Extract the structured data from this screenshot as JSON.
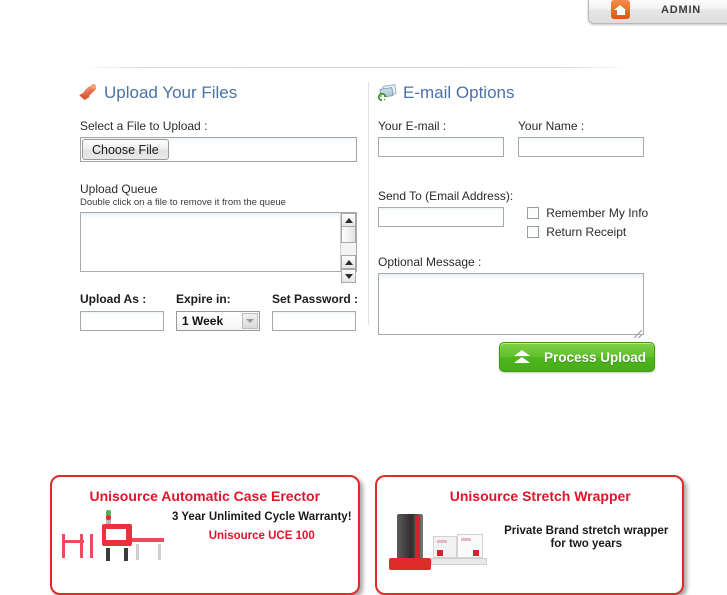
{
  "header": {
    "admin_label": "ADMIN",
    "admin_icon": "home-icon"
  },
  "upload_section": {
    "icon": "rocket-icon",
    "title": "Upload Your Files",
    "select_file_label": "Select a File to Upload :",
    "choose_file_button": "Choose File",
    "file_input_value": "",
    "queue_label": "Upload Queue",
    "queue_hint": "Double click on a file to remove it from the queue",
    "queue_value": "",
    "upload_as_label": "Upload As :",
    "upload_as_value": "",
    "expire_label": "Expire in:",
    "expire_value": "1 Week",
    "expire_options": [
      "1 Week"
    ],
    "password_label": "Set Password :",
    "password_value": ""
  },
  "email_section": {
    "icon": "mail-icon",
    "title": "E-mail Options",
    "your_email_label": "Your E-mail :",
    "your_email_value": "",
    "your_name_label": "Your Name :",
    "your_name_value": "",
    "send_to_label": "Send To (Email Address):",
    "send_to_value": "",
    "remember_label": "Remember My Info",
    "remember_checked": false,
    "receipt_label": "Return Receipt",
    "receipt_checked": false,
    "optional_message_label": "Optional Message :",
    "optional_message_value": ""
  },
  "actions": {
    "process_upload_label": "Process Upload",
    "process_upload_icon": "double-chevron-up-icon",
    "process_upload_color": "#4fb61e"
  },
  "ads": [
    {
      "title": "Unisource Automatic Case Erector",
      "line1": "3 Year Unlimited Cycle Warranty!",
      "line2": "Unisource UCE 100",
      "border_color": "#e02b2b",
      "title_color": "#e1142b"
    },
    {
      "title": "Unisource Stretch Wrapper",
      "line1": "Private Brand stretch wrapper",
      "line2": "for two years",
      "border_color": "#e02b2b",
      "title_color": "#e1142b"
    }
  ]
}
